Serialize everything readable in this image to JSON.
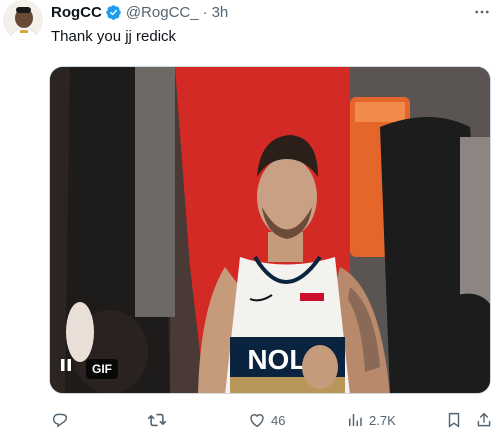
{
  "author": {
    "display_name": "RogCC",
    "handle": "@RogCC_",
    "separator": "·",
    "time": "3h",
    "verified": true,
    "avatar": "avatar-image"
  },
  "tweet": {
    "text": "Thank you jj redick"
  },
  "media": {
    "type": "gif",
    "badge": "GIF",
    "jersey_text": "NOLA",
    "pause_icon": "pause-icon"
  },
  "actions": {
    "reply": {
      "icon": "reply-icon",
      "count": ""
    },
    "retweet": {
      "icon": "retweet-icon",
      "count": ""
    },
    "like": {
      "icon": "heart-icon",
      "count": "46"
    },
    "views": {
      "icon": "views-icon",
      "count": "2.7K"
    },
    "bookmark": {
      "icon": "bookmark-icon"
    },
    "share": {
      "icon": "share-icon"
    }
  },
  "colors": {
    "verified": "#1d9bf0",
    "muted": "#536471",
    "text": "#0f1419"
  }
}
